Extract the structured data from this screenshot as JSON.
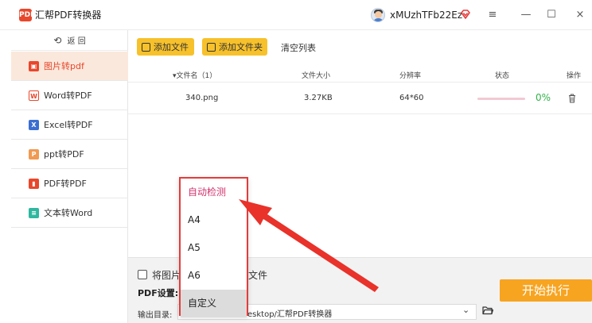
{
  "window": {
    "app_logo_text": "PDF",
    "app_title": "汇帮PDF转换器",
    "username": "xMUzhTFb22Ez",
    "menu_glyph": "≡",
    "minimize_glyph": "—",
    "maximize_glyph": "☐",
    "close_glyph": "×"
  },
  "sidebar": {
    "back_icon": "⟲",
    "back_label": "返 回",
    "items": [
      {
        "label": "图片转pdf",
        "icon": "image-icon",
        "icon_color": "#e8472c",
        "active": true
      },
      {
        "label": "Word转PDF",
        "icon": "word-icon",
        "icon_color": "#e8472c",
        "active": false
      },
      {
        "label": "Excel转PDF",
        "icon": "excel-icon",
        "icon_color": "#3a6fd1",
        "active": false
      },
      {
        "label": "ppt转PDF",
        "icon": "ppt-icon",
        "icon_color": "#f09a52",
        "active": false
      },
      {
        "label": "PDF转PDF",
        "icon": "pdf-icon",
        "icon_color": "#e8472c",
        "active": false
      },
      {
        "label": "文本转Word",
        "icon": "text-icon",
        "icon_color": "#2fb7a0",
        "active": false
      }
    ]
  },
  "toolbar": {
    "add_file_label": "添加文件",
    "add_folder_label": "添加文件夹",
    "clear_list_label": "清空列表"
  },
  "table": {
    "columns": [
      "▾文件名（1）",
      "文件大小",
      "分辨率",
      "状态",
      "操作"
    ],
    "rows": [
      {
        "name": "340.png",
        "size": "3.27KB",
        "resolution": "64*60",
        "status": "0%",
        "progress": 0
      }
    ]
  },
  "bottom": {
    "merge_text_a": "将图片",
    "merge_text_b": "文件",
    "pdf_settings_label": "PDF设置:",
    "output_label": "输出目录:",
    "output_path": "esktop/汇帮PDF转换器",
    "path_chevron": "⌄",
    "start_label": "开始执行"
  },
  "dropdown": {
    "options": [
      "自动检测",
      "A4",
      "A5",
      "A6",
      "自定义"
    ],
    "selected": "自动检测",
    "hovered": "自定义"
  },
  "colors": {
    "accent": "#e8472c",
    "toolbar_button": "#f7c12b",
    "start_button": "#f7a421",
    "status_green": "#33b24a",
    "annotation_red": "#e53b3b"
  }
}
